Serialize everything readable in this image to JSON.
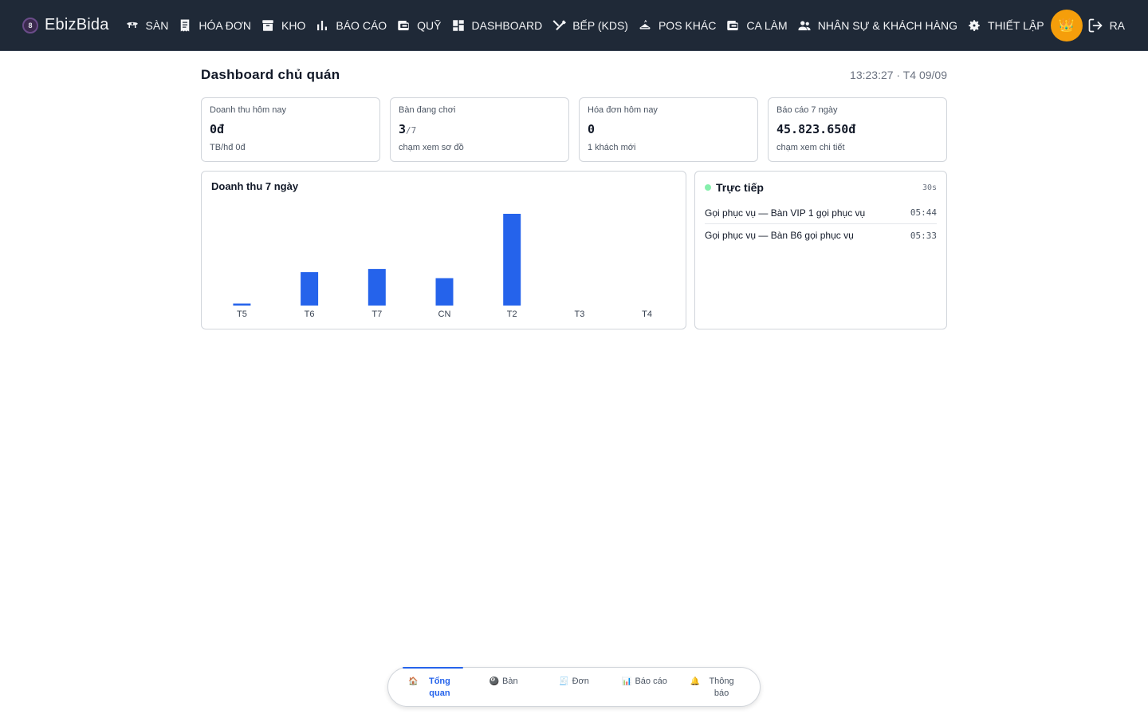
{
  "app": {
    "brand": "EbizBida"
  },
  "nav": [
    {
      "label": "SÀN",
      "icon": "table-icon"
    },
    {
      "label": "HÓA ĐƠN",
      "icon": "receipt-icon"
    },
    {
      "label": "KHO",
      "icon": "archive-icon"
    },
    {
      "label": "BÁO CÁO",
      "icon": "bar-chart-icon"
    },
    {
      "label": "QUỸ",
      "icon": "wallet-icon"
    },
    {
      "label": "DASHBOARD",
      "icon": "dashboard-icon"
    },
    {
      "label": "BẾP (KDS)",
      "icon": "utensils-icon"
    },
    {
      "label": "POS KHÁC",
      "icon": "hanger-icon"
    },
    {
      "label": "CA LÀM",
      "icon": "wallet-icon"
    },
    {
      "label": "NHÂN SỰ & KHÁCH HÀNG",
      "icon": "people-icon"
    },
    {
      "label": "THIẾT LẬP",
      "icon": "gear-icon"
    }
  ],
  "user": {
    "avatar": "👑",
    "logout_label": "RA"
  },
  "page": {
    "title": "Dashboard chủ quán",
    "clock": "13:23:27 · T4 09/09"
  },
  "kpis": [
    {
      "label": "Doanh thu hôm nay",
      "value": "0đ",
      "sub": "",
      "note": "TB/hđ 0đ"
    },
    {
      "label": "Bàn đang chơi",
      "value": "3",
      "sub": "/7",
      "note": "chạm xem sơ đồ"
    },
    {
      "label": "Hóa đơn hôm nay",
      "value": "0",
      "sub": "",
      "note": "1 khách mới"
    },
    {
      "label": "Báo cáo 7 ngày",
      "value": "45.823.650đ",
      "sub": "",
      "note": "chạm xem chi tiết"
    }
  ],
  "chart": {
    "card_title": "Doanh thu 7 ngày"
  },
  "chart_data": {
    "type": "bar",
    "title": "Doanh thu 7 ngày",
    "categories": [
      "T5",
      "T6",
      "T7",
      "CN",
      "T2",
      "T3",
      "T4"
    ],
    "values": [
      0.5,
      8.3,
      9.1,
      6.8,
      22.8,
      0,
      0
    ],
    "xlabel": "",
    "ylabel": "",
    "ylim": [
      0,
      23
    ],
    "grid": false,
    "color": "#2563eb"
  },
  "live": {
    "title": "Trực tiếp",
    "interval": "30s",
    "items": [
      {
        "text": "Gọi phục vụ — Bàn VIP 1 gọi phục vụ",
        "time": "05:44"
      },
      {
        "text": "Gọi phục vụ — Bàn B6 gọi phục vụ",
        "time": "05:33"
      }
    ]
  },
  "tabs": [
    {
      "label": "Tổng quan",
      "icon": "🏠",
      "active": true
    },
    {
      "label": "Bàn",
      "icon": "🎱",
      "active": false
    },
    {
      "label": "Đơn",
      "icon": "🧾",
      "active": false
    },
    {
      "label": "Báo cáo",
      "icon": "📊",
      "active": false
    },
    {
      "label": "Thông báo",
      "icon": "🔔",
      "active": false
    }
  ],
  "colors": {
    "topbar": "#1f2937",
    "accent": "#2563eb",
    "avatar": "#f59e0b",
    "live": "#86efac"
  }
}
